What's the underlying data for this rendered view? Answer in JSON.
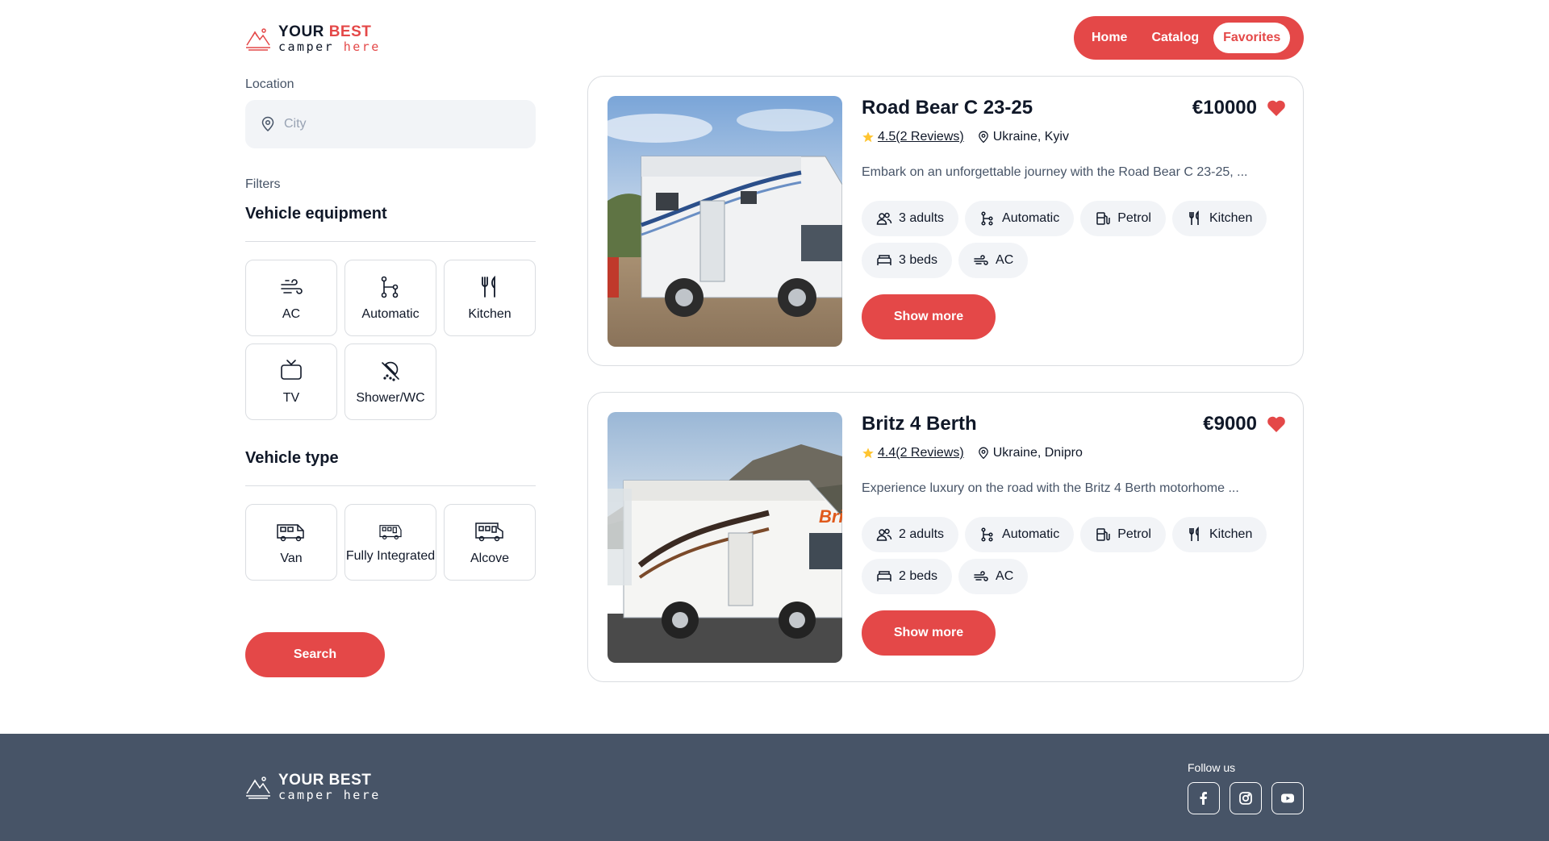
{
  "header": {
    "brand_part1": "YOUR ",
    "brand_part2": "BEST",
    "sub_part1": "camper ",
    "sub_part2": "here",
    "nav": [
      {
        "label": "Home"
      },
      {
        "label": "Catalog"
      },
      {
        "label": "Favorites",
        "active": true
      }
    ]
  },
  "sidebar": {
    "location_label": "Location",
    "location_placeholder": "City",
    "filters_label": "Filters",
    "equipment_title": "Vehicle equipment",
    "equipment": [
      {
        "label": "AC",
        "icon": "wind-icon"
      },
      {
        "label": "Automatic",
        "icon": "transmission-icon"
      },
      {
        "label": "Kitchen",
        "icon": "cutlery-icon"
      },
      {
        "label": "TV",
        "icon": "tv-icon"
      },
      {
        "label": "Shower/WC",
        "icon": "shower-icon"
      }
    ],
    "type_title": "Vehicle type",
    "types": [
      {
        "label": "Van",
        "icon": "van-icon"
      },
      {
        "label": "Fully Integrated",
        "icon": "fully-integrated-icon"
      },
      {
        "label": "Alcove",
        "icon": "alcove-icon"
      }
    ],
    "search_label": "Search"
  },
  "cards": [
    {
      "name": "Road Bear C 23-25",
      "price": "€10000",
      "rating": "4.5",
      "reviews": "(2 Reviews)",
      "location": "Ukraine, Kyiv",
      "description": "Embark on an unforgettable journey with the Road Bear C 23-25, ...",
      "chips": [
        {
          "label": "3 adults",
          "icon": "users-icon"
        },
        {
          "label": "Automatic",
          "icon": "transmission-icon"
        },
        {
          "label": "Petrol",
          "icon": "fuel-icon"
        },
        {
          "label": "Kitchen",
          "icon": "cutlery-icon"
        },
        {
          "label": "3 beds",
          "icon": "bed-icon"
        },
        {
          "label": "AC",
          "icon": "wind-icon"
        }
      ],
      "button": "Show more"
    },
    {
      "name": "Britz 4 Berth",
      "price": "€9000",
      "rating": "4.4",
      "reviews": "(2 Reviews)",
      "location": "Ukraine, Dnipro",
      "description": "Experience luxury on the road with the Britz 4 Berth motorhome ...",
      "chips": [
        {
          "label": "2 adults",
          "icon": "users-icon"
        },
        {
          "label": "Automatic",
          "icon": "transmission-icon"
        },
        {
          "label": "Petrol",
          "icon": "fuel-icon"
        },
        {
          "label": "Kitchen",
          "icon": "cutlery-icon"
        },
        {
          "label": "2 beds",
          "icon": "bed-icon"
        },
        {
          "label": "AC",
          "icon": "wind-icon"
        }
      ],
      "button": "Show more"
    }
  ],
  "footer": {
    "brand_part1": "YOUR BEST",
    "sub": "camper here",
    "follow_label": "Follow us",
    "socials": [
      "facebook-icon",
      "instagram-icon",
      "youtube-icon"
    ]
  },
  "colors": {
    "accent": "#E44848",
    "text": "#101828",
    "muted": "#475467",
    "surface": "#F2F4F7",
    "border": "#DADDE1",
    "footer": "#475467",
    "star": "#FFC531"
  }
}
